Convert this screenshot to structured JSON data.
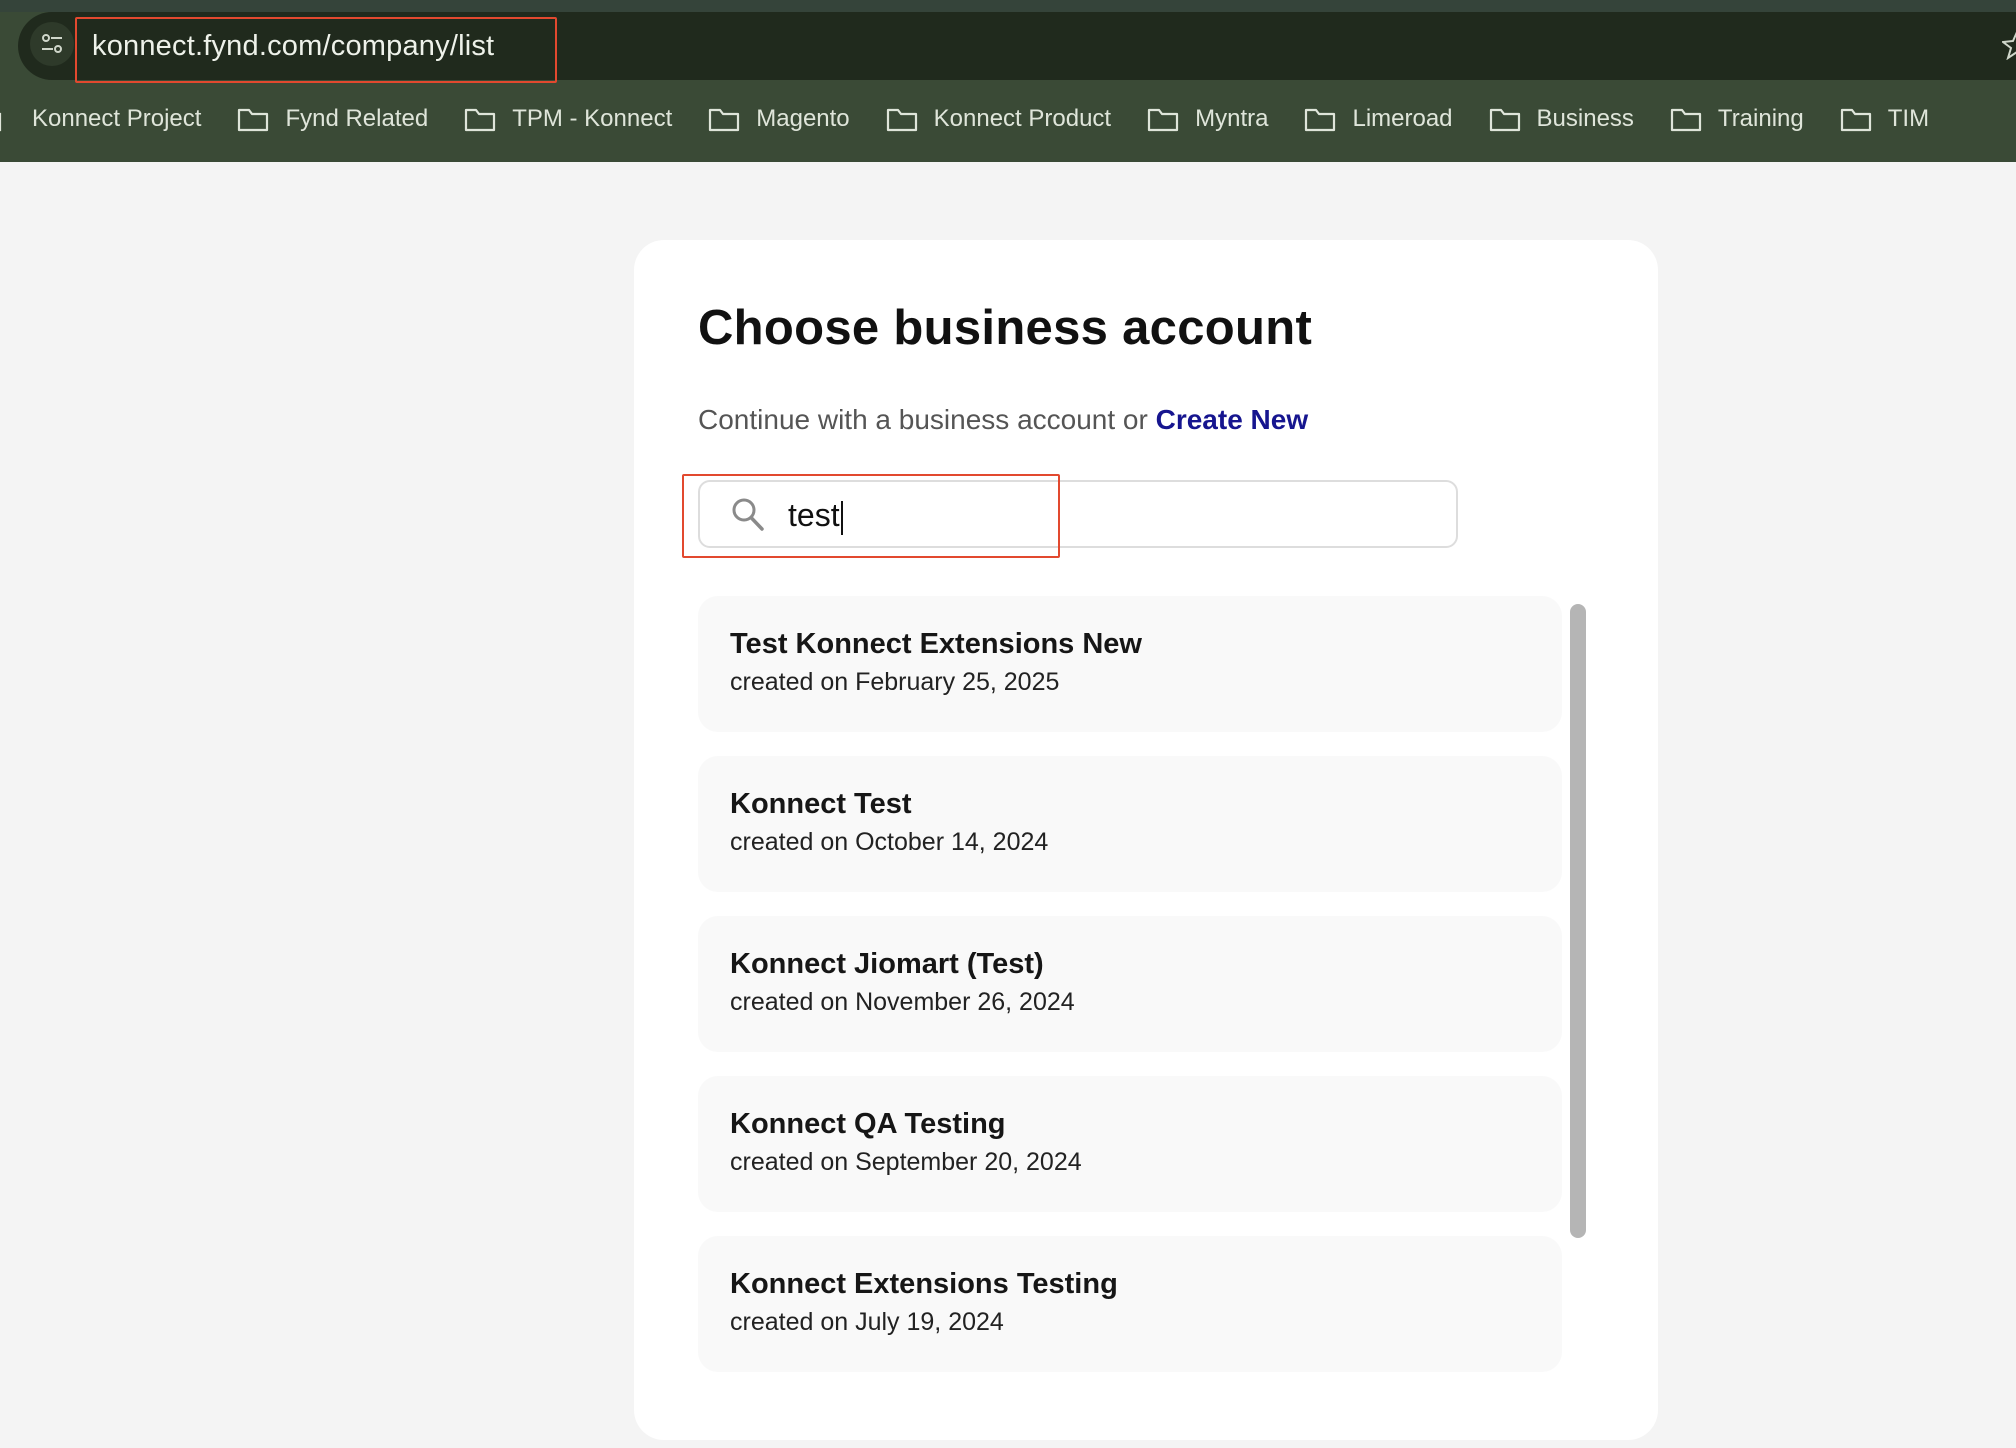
{
  "browser": {
    "url": "konnect.fynd.com/company/list",
    "bookmarks": [
      {
        "label": "Konnect Project",
        "partial": true
      },
      {
        "label": "Fynd Related"
      },
      {
        "label": "TPM - Konnect"
      },
      {
        "label": "Magento"
      },
      {
        "label": "Konnect Product"
      },
      {
        "label": "Myntra"
      },
      {
        "label": "Limeroad"
      },
      {
        "label": "Business"
      },
      {
        "label": "Training"
      },
      {
        "label": "TIM"
      }
    ]
  },
  "page": {
    "title": "Choose business account",
    "subtitle": "Continue with a business account or",
    "create_new_label": "Create New",
    "search": {
      "value": "test",
      "icon": "search-icon"
    },
    "accounts": [
      {
        "name": "Test Konnect Extensions New",
        "created": "created on February 25, 2025"
      },
      {
        "name": "Konnect Test",
        "created": "created on October 14, 2024"
      },
      {
        "name": "Konnect Jiomart (Test)",
        "created": "created on November 26, 2024"
      },
      {
        "name": "Konnect QA Testing",
        "created": "created on September 20, 2024"
      },
      {
        "name": "Konnect Extensions Testing",
        "created": "created on July 19, 2024"
      }
    ]
  },
  "colors": {
    "accent_link": "#16158f",
    "annotation_red": "#e2492f",
    "chrome_bg": "#3a4a36"
  }
}
